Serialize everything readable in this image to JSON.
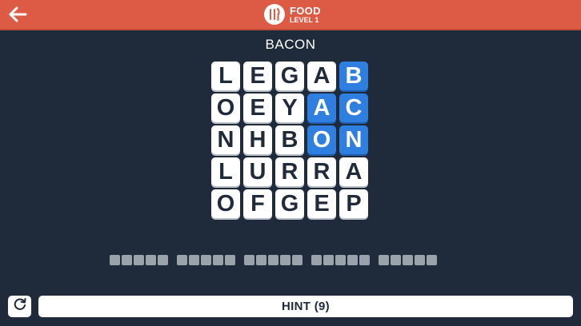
{
  "header": {
    "category": "FOOD",
    "level": "LEVEL 1",
    "back_icon": "arrow-left-icon",
    "category_icon": "utensils-icon",
    "bar_color": "#dd5a45"
  },
  "current_word": "BACON",
  "grid": {
    "rows": [
      [
        "L",
        "E",
        "G",
        "A",
        "B"
      ],
      [
        "O",
        "E",
        "Y",
        "A",
        "C"
      ],
      [
        "N",
        "H",
        "B",
        "O",
        "N"
      ],
      [
        "L",
        "U",
        "R",
        "R",
        "A"
      ],
      [
        "O",
        "F",
        "G",
        "E",
        "P"
      ]
    ],
    "selected": [
      [
        0,
        4
      ],
      [
        1,
        3
      ],
      [
        1,
        4
      ],
      [
        2,
        3
      ],
      [
        2,
        4
      ]
    ],
    "selected_color": "#2f7fe0",
    "tile_color": "#ffffff"
  },
  "answer_slots": {
    "groups": [
      5,
      5,
      5,
      5,
      5
    ],
    "slot_color": "#9aa3ab"
  },
  "footer": {
    "reset_icon": "refresh-icon",
    "hint_label": "HINT (9)"
  }
}
